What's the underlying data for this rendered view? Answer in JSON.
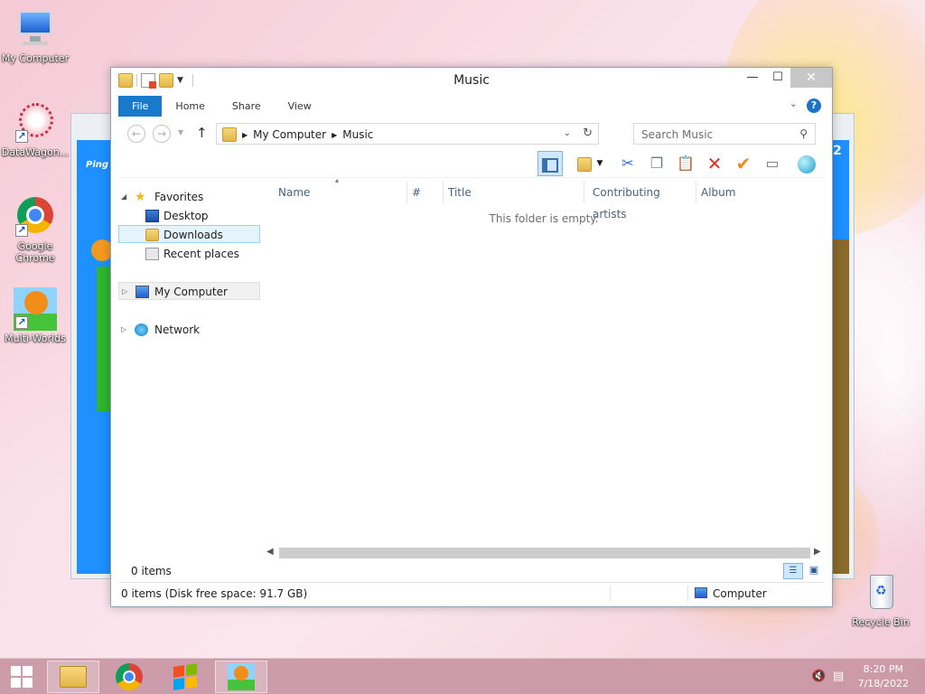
{
  "desktop": {
    "icons": [
      {
        "label": "My Computer"
      },
      {
        "label": "DataWagon..."
      },
      {
        "label": "Google Chrome"
      },
      {
        "label": "Multi-Worlds"
      },
      {
        "label": "Recycle Bin"
      }
    ],
    "background_game_text": "Ping"
  },
  "window": {
    "title": "Music",
    "controls": {
      "minimize": "—",
      "maximize": "☐",
      "close": "✕"
    },
    "ribbon": {
      "tabs": [
        "File",
        "Home",
        "Share",
        "View"
      ],
      "help": "?"
    },
    "address": {
      "crumbs": [
        "My Computer",
        "Music"
      ]
    },
    "search": {
      "placeholder": "Search Music"
    },
    "navigation": {
      "favorites": "Favorites",
      "favorites_items": [
        "Desktop",
        "Downloads",
        "Recent places"
      ],
      "computer": "My Computer",
      "network": "Network"
    },
    "columns": [
      "Name",
      "#",
      "Title",
      "Contributing artists",
      "Album"
    ],
    "empty_message": "This folder is empty.",
    "item_count": "0 items",
    "status": {
      "left": "0 items (Disk free space: 91.7 GB)",
      "right": "Computer"
    }
  },
  "taskbar": {
    "time": "8:20 PM",
    "date": "7/18/2022"
  }
}
